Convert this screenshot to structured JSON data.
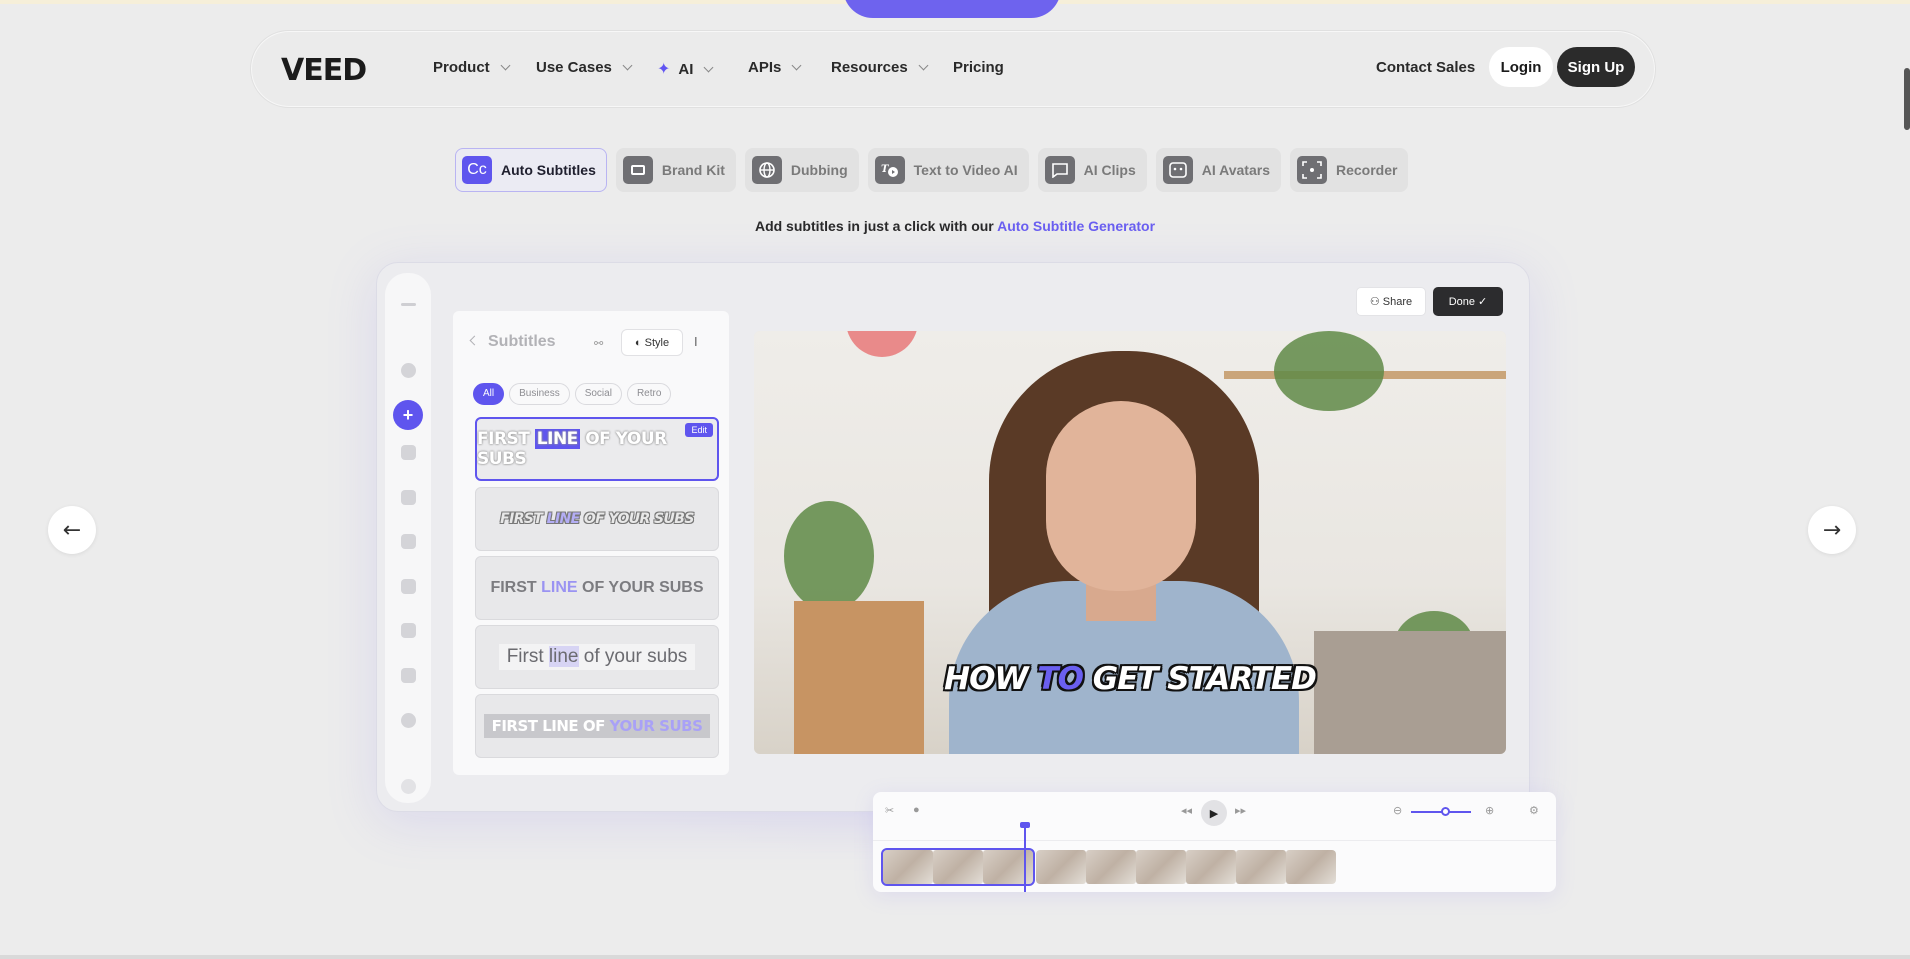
{
  "nav": {
    "logo": "VEED",
    "items": [
      {
        "label": "Product"
      },
      {
        "label": "Use Cases"
      },
      {
        "label": "AI"
      },
      {
        "label": "APIs"
      },
      {
        "label": "Resources"
      },
      {
        "label": "Pricing"
      }
    ],
    "contact_label": "Contact Sales",
    "login_label": "Login",
    "signup_label": "Sign Up"
  },
  "feature_tabs": [
    {
      "label": "Auto Subtitles",
      "icon": "cc-icon",
      "icon_text": "Cc",
      "active": true
    },
    {
      "label": "Brand Kit",
      "icon": "brand-kit-icon"
    },
    {
      "label": "Dubbing",
      "icon": "globe-icon"
    },
    {
      "label": "Text to Video AI",
      "icon": "text-to-video-icon"
    },
    {
      "label": "AI Clips",
      "icon": "clips-icon"
    },
    {
      "label": "AI Avatars",
      "icon": "avatar-icon"
    },
    {
      "label": "Recorder",
      "icon": "recorder-icon"
    }
  ],
  "tagline": {
    "prefix": "Add subtitles in just a click with our ",
    "link": "Auto Subtitle Generator"
  },
  "editor": {
    "panel_title": "Subtitles",
    "style_label": "Style",
    "filters": [
      "All",
      "Business",
      "Social",
      "Retro"
    ],
    "edit_badge": "Edit",
    "styles": [
      {
        "pre": "FIRST ",
        "hl": "LINE",
        "post": " OF YOUR SUBS"
      },
      {
        "pre": "FIRST ",
        "hl": "LINE",
        "post": " OF YOUR SUBS"
      },
      {
        "pre": "FIRST ",
        "hl": "LINE",
        "post": " OF YOUR SUBS"
      },
      {
        "pre": "First ",
        "hl": "line",
        "post": " of your subs"
      },
      {
        "pre": "FIRST LINE OF ",
        "hl": "YOUR SUBS",
        "post": ""
      }
    ],
    "share_label": "Share",
    "done_label": "Done",
    "caption": {
      "pre": "HOW ",
      "hl": "TO",
      "post": " GET STARTED"
    }
  },
  "colors": {
    "accent": "#5f55ee",
    "background": "#ececec",
    "dark_button": "#2b2b2b"
  }
}
